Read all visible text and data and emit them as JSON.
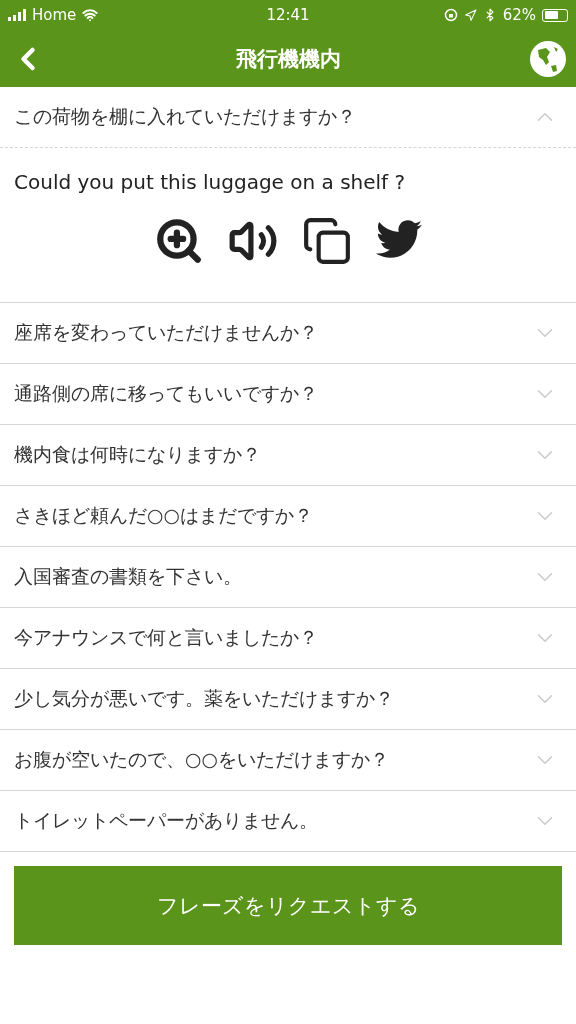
{
  "status_bar": {
    "carrier": "Home",
    "time": "12:41",
    "battery": "62%"
  },
  "nav": {
    "title": "飛行機機内"
  },
  "phrases": [
    {
      "text": "この荷物を棚に入れていただけますか？",
      "expanded": true,
      "translation": "Could you put this luggage on a shelf ?"
    },
    {
      "text": "座席を変わっていただけませんか？",
      "expanded": false
    },
    {
      "text": "通路側の席に移ってもいいですか？",
      "expanded": false
    },
    {
      "text": "機内食は何時になりますか？",
      "expanded": false
    },
    {
      "text": "さきほど頼んだ○○はまだですか？",
      "expanded": false
    },
    {
      "text": "入国審査の書類を下さい。",
      "expanded": false
    },
    {
      "text": "今アナウンスで何と言いましたか？",
      "expanded": false
    },
    {
      "text": "少し気分が悪いです。薬をいただけますか？",
      "expanded": false
    },
    {
      "text": "お腹が空いたので、○○をいただけますか？",
      "expanded": false
    },
    {
      "text": "トイレットペーパーがありません。",
      "expanded": false
    }
  ],
  "request_button": "フレーズをリクエストする"
}
